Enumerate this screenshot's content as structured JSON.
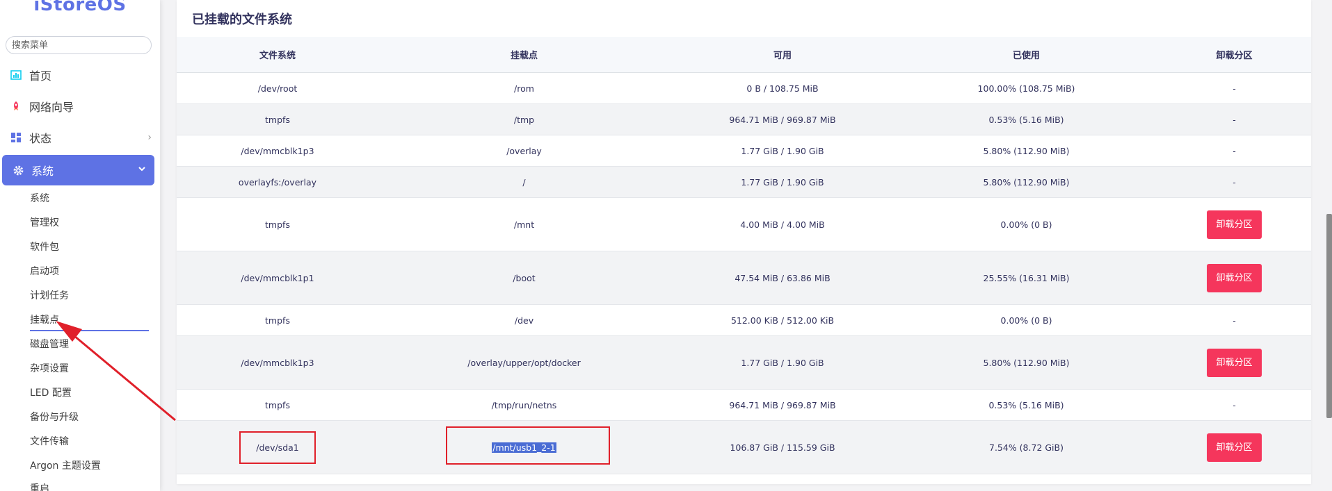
{
  "brand": {
    "logo": "iStoreOS",
    "accent": "#5e72e4",
    "danger": "#f5365c",
    "highlight": "#e0202a"
  },
  "sidebar": {
    "search_placeholder": "搜索菜单",
    "items": [
      {
        "label": "首页",
        "icon": "bar-chart-icon"
      },
      {
        "label": "网络向导",
        "icon": "rocket-icon"
      },
      {
        "label": "状态",
        "icon": "dashboard-icon",
        "chevron": "›"
      },
      {
        "label": "系统",
        "icon": "gear-icon",
        "chevron": "⌄",
        "active": true
      }
    ],
    "sub_items": [
      "系统",
      "管理权",
      "软件包",
      "启动项",
      "计划任务",
      "挂载点",
      "磁盘管理",
      "杂项设置",
      "LED 配置",
      "备份与升级",
      "文件传输",
      "Argon 主题设置",
      "重启"
    ]
  },
  "main": {
    "title": "已挂载的文件系统",
    "columns": [
      "文件系统",
      "挂载点",
      "可用",
      "已使用",
      "卸载分区"
    ],
    "unmount_label": "卸载分区",
    "rows": [
      {
        "fs": "/dev/root",
        "mount": "/rom",
        "avail": "0 B / 108.75 MiB",
        "used": "100.00% (108.75 MiB)",
        "action": "-"
      },
      {
        "fs": "tmpfs",
        "mount": "/tmp",
        "avail": "964.71 MiB / 969.87 MiB",
        "used": "0.53% (5.16 MiB)",
        "action": "-"
      },
      {
        "fs": "/dev/mmcblk1p3",
        "mount": "/overlay",
        "avail": "1.77 GiB / 1.90 GiB",
        "used": "5.80% (112.90 MiB)",
        "action": "-"
      },
      {
        "fs": "overlayfs:/overlay",
        "mount": "/",
        "avail": "1.77 GiB / 1.90 GiB",
        "used": "5.80% (112.90 MiB)",
        "action": "-"
      },
      {
        "fs": "tmpfs",
        "mount": "/mnt",
        "avail": "4.00 MiB / 4.00 MiB",
        "used": "0.00% (0 B)",
        "action": "卸载分区"
      },
      {
        "fs": "/dev/mmcblk1p1",
        "mount": "/boot",
        "avail": "47.54 MiB / 63.86 MiB",
        "used": "25.55% (16.31 MiB)",
        "action": "卸载分区"
      },
      {
        "fs": "tmpfs",
        "mount": "/dev",
        "avail": "512.00 KiB / 512.00 KiB",
        "used": "0.00% (0 B)",
        "action": "-"
      },
      {
        "fs": "/dev/mmcblk1p3",
        "mount": "/overlay/upper/opt/docker",
        "avail": "1.77 GiB / 1.90 GiB",
        "used": "5.80% (112.90 MiB)",
        "action": "卸载分区"
      },
      {
        "fs": "tmpfs",
        "mount": "/tmp/run/netns",
        "avail": "964.71 MiB / 969.87 MiB",
        "used": "0.53% (5.16 MiB)",
        "action": "-"
      },
      {
        "fs": "/dev/sda1",
        "mount": "/mnt/usb1_2-1",
        "avail": "106.87 GiB / 115.59 GiB",
        "used": "7.54% (8.72 GiB)",
        "action": "卸载分区"
      }
    ]
  }
}
